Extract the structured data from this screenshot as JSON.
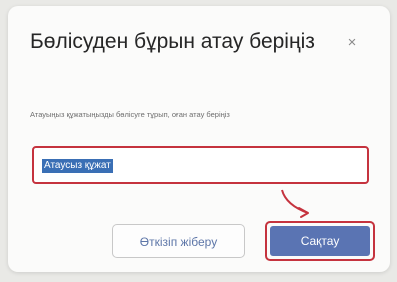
{
  "dialog": {
    "title": "Бөлісуден бұрын атау беріңіз",
    "close_symbol": "×",
    "subtitle": "Атауыңыз құжатыңызды бөлісуге тұрып, оған атау беріңіз",
    "input": {
      "value": "Атаусыз құжат",
      "selected": true
    },
    "buttons": {
      "secondary_label": "Өткізіп жіберу",
      "primary_label": "Сақтау"
    }
  },
  "colors": {
    "primary": "#5a74b3",
    "highlight_annotation": "#c5333e",
    "selection": "#3a6fb5"
  },
  "icons": {
    "close": "close-icon",
    "annotation_arrow": "arrow-icon"
  }
}
